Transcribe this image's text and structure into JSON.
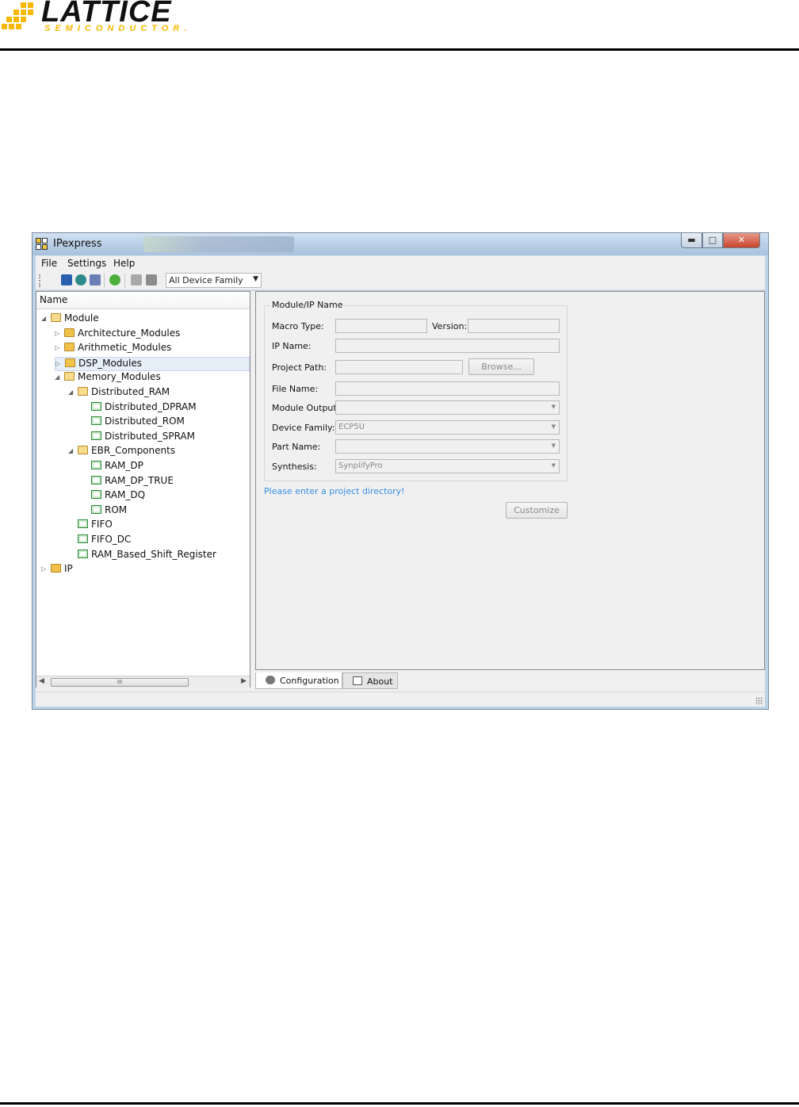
{
  "doc": {
    "logo_main": "LATTICE",
    "logo_sub": "SEMICONDUCTOR."
  },
  "window": {
    "title": "IPexpress",
    "menu": [
      "File",
      "Settings",
      "Help"
    ],
    "toolbar": {
      "device_family": "All Device Family"
    },
    "tree": {
      "header": "Name",
      "items": [
        {
          "label": "Module",
          "depth": 0,
          "state": "expanded",
          "icon": "folder-open-icon"
        },
        {
          "label": "Architecture_Modules",
          "depth": 1,
          "state": "collapsed",
          "icon": "folder-icon"
        },
        {
          "label": "Arithmetic_Modules",
          "depth": 1,
          "state": "collapsed",
          "icon": "folder-icon"
        },
        {
          "label": "DSP_Modules",
          "depth": 1,
          "state": "collapsed",
          "icon": "folder-icon",
          "selected": true
        },
        {
          "label": "Memory_Modules",
          "depth": 1,
          "state": "expanded",
          "icon": "folder-open-icon"
        },
        {
          "label": "Distributed_RAM",
          "depth": 2,
          "state": "expanded",
          "icon": "folder-open-icon"
        },
        {
          "label": "Distributed_DPRAM",
          "depth": 3,
          "state": "leaf",
          "icon": "chip-icon"
        },
        {
          "label": "Distributed_ROM",
          "depth": 3,
          "state": "leaf",
          "icon": "chip-icon"
        },
        {
          "label": "Distributed_SPRAM",
          "depth": 3,
          "state": "leaf",
          "icon": "chip-icon"
        },
        {
          "label": "EBR_Components",
          "depth": 2,
          "state": "expanded",
          "icon": "folder-open-icon"
        },
        {
          "label": "RAM_DP",
          "depth": 3,
          "state": "leaf",
          "icon": "chip-icon"
        },
        {
          "label": "RAM_DP_TRUE",
          "depth": 3,
          "state": "leaf",
          "icon": "chip-icon"
        },
        {
          "label": "RAM_DQ",
          "depth": 3,
          "state": "leaf",
          "icon": "chip-icon"
        },
        {
          "label": "ROM",
          "depth": 3,
          "state": "leaf",
          "icon": "chip-icon"
        },
        {
          "label": "FIFO",
          "depth": 2,
          "state": "leaf",
          "icon": "chip-icon"
        },
        {
          "label": "FIFO_DC",
          "depth": 2,
          "state": "leaf",
          "icon": "chip-icon"
        },
        {
          "label": "RAM_Based_Shift_Register",
          "depth": 2,
          "state": "leaf",
          "icon": "chip-icon"
        },
        {
          "label": "IP",
          "depth": 0,
          "state": "collapsed",
          "icon": "folder-icon"
        }
      ],
      "scroll_thumb": "III"
    },
    "form": {
      "group_title": "Module/IP Name",
      "macro_type_label": "Macro Type:",
      "macro_type_value": "",
      "version_label": "Version:",
      "version_value": "",
      "ip_name_label": "IP Name:",
      "ip_name_value": "",
      "project_path_label": "Project Path:",
      "project_path_value": "",
      "browse_button": "Browse...",
      "file_name_label": "File Name:",
      "file_name_value": "",
      "module_output_label": "Module Output:",
      "module_output_value": "",
      "device_family_label": "Device Family:",
      "device_family_value": "ECP5U",
      "part_name_label": "Part Name:",
      "part_name_value": "",
      "synthesis_label": "Synthesis:",
      "synthesis_value": "SynplifyPro",
      "hint": "Please enter a project directory!",
      "customize_button": "Customize"
    },
    "tabs": [
      {
        "label": "Configuration",
        "active": true
      },
      {
        "label": "About",
        "active": false
      }
    ]
  }
}
